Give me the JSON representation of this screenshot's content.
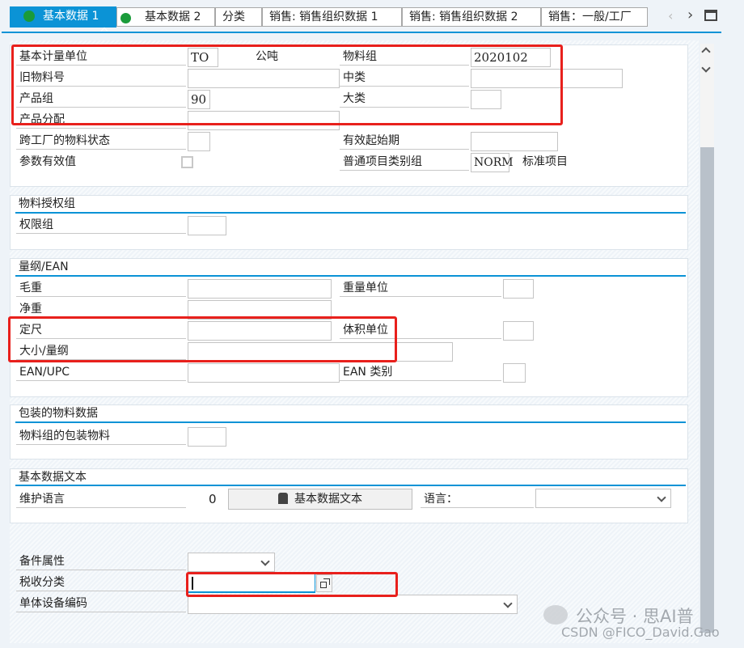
{
  "tabs": [
    {
      "label": "基本数据 1",
      "active": true
    },
    {
      "label": "基本数据 2"
    },
    {
      "label": "分类"
    },
    {
      "label": "销售: 销售组织数据 1"
    },
    {
      "label": "销售: 销售组织数据 2"
    },
    {
      "label": "销售：一般/工厂"
    }
  ],
  "general": {
    "base_unit_label": "基本计量单位",
    "base_unit_value": "TO",
    "base_unit_text": "公吨",
    "material_group_label": "物料组",
    "material_group_value": "2020102",
    "old_material_label": "旧物料号",
    "mid_class_label": "中类",
    "division_label": "产品组",
    "division_value": "90",
    "major_class_label": "大类",
    "product_alloc_label": "产品分配",
    "cross_plant_status_label": "跨工厂的物料状态",
    "valid_from_label": "有效起始期",
    "param_effectivity_label": "参数有效值",
    "item_cat_group_label": "普通项目类别组",
    "item_cat_group_value": "NORM",
    "item_cat_group_text": "标准项目"
  },
  "auth": {
    "title": "物料授权组",
    "auth_group_label": "权限组"
  },
  "dims": {
    "title": "量纲/EAN",
    "gross_weight_label": "毛重",
    "weight_unit_label": "重量单位",
    "net_weight_label": "净重",
    "fixed_size_label": "定尺",
    "volume_unit_label": "体积单位",
    "size_dims_label": "大小/量纲",
    "ean_label": "EAN/UPC",
    "ean_cat_label": "EAN 类别"
  },
  "packaging": {
    "title": "包装的物料数据",
    "pkg_material_label": "物料组的包装物料"
  },
  "text": {
    "title": "基本数据文本",
    "maint_lang_label": "维护语言",
    "maint_lang_count": "0",
    "button_label": "基本数据文本",
    "lang_label": "语言："
  },
  "other": {
    "spare_part_label": "备件属性",
    "tax_class_label": "税收分类",
    "equip_code_label": "单体设备编码"
  },
  "watermark": {
    "line1": "公众号 · 思AI普",
    "line2": "CSDN @FICO_David.Gao"
  },
  "colors": {
    "accent": "#0b93d6",
    "highlight": "#e8201c"
  }
}
